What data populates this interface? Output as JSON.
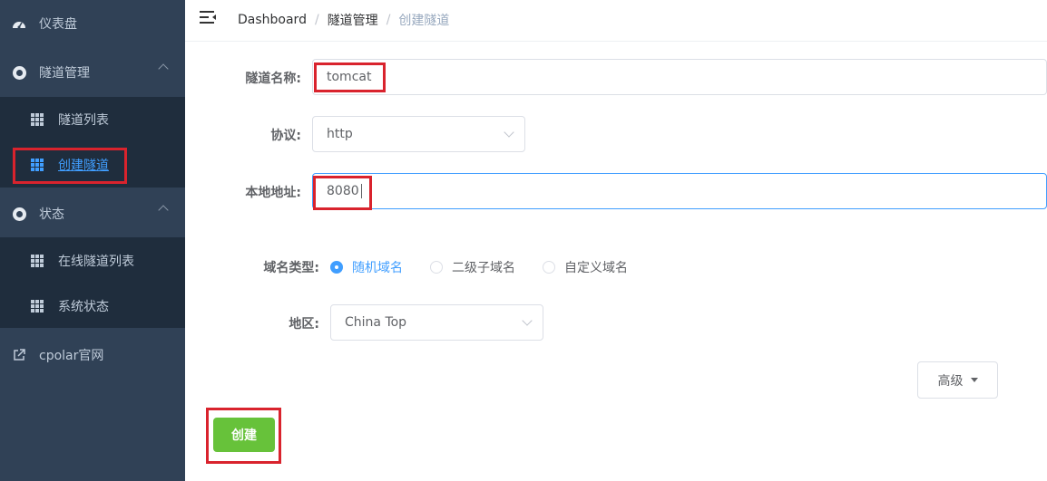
{
  "sidebar": {
    "items": [
      {
        "label": "仪表盘",
        "icon": "dashboard-icon"
      },
      {
        "label": "隧道管理",
        "icon": "circle-icon",
        "children": [
          {
            "label": "隧道列表",
            "icon": "table-icon"
          },
          {
            "label": "创建隧道",
            "icon": "table-icon",
            "active": true
          }
        ]
      },
      {
        "label": "状态",
        "icon": "circle-icon",
        "children": [
          {
            "label": "在线隧道列表",
            "icon": "table-icon"
          },
          {
            "label": "系统状态",
            "icon": "table-icon"
          }
        ]
      },
      {
        "label": "cpolar官网",
        "icon": "external-link-icon"
      }
    ]
  },
  "breadcrumb": [
    "Dashboard",
    "隧道管理",
    "创建隧道"
  ],
  "form": {
    "tunnel_name_label": "隧道名称:",
    "tunnel_name_value": "tomcat",
    "protocol_label": "协议:",
    "protocol_value": "http",
    "local_address_label": "本地地址:",
    "local_address_value": "8080",
    "domain_type_label": "域名类型:",
    "domain_type_options": [
      "随机域名",
      "二级子域名",
      "自定义域名"
    ],
    "domain_type_selected": "随机域名",
    "region_label": "地区:",
    "region_value": "China Top",
    "advanced_label": "高级",
    "create_label": "创建"
  },
  "colors": {
    "sidebar_bg": "#304156",
    "submenu_bg": "#1f2d3d",
    "accent": "#409eff",
    "create_button": "#67c23a",
    "highlight_box": "#d9232d"
  }
}
